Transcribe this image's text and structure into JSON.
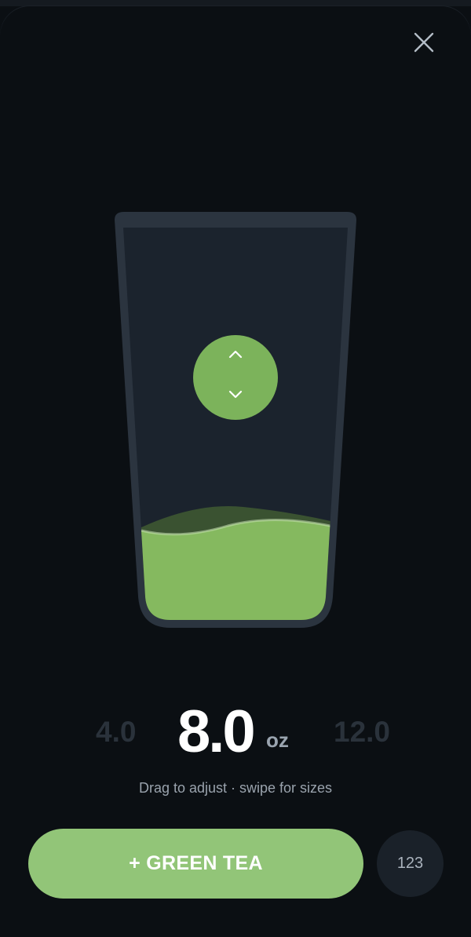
{
  "close": {
    "icon": "close-icon"
  },
  "glass": {
    "fill_fraction": 0.22,
    "liquid_color": "#85b95f",
    "glass_color": "#1b232d",
    "rim_color": "#2b343f"
  },
  "handle": {
    "up_icon": "chevron-up-icon",
    "down_icon": "chevron-down-icon",
    "color": "#7cb35b"
  },
  "sizes": {
    "previous": "4.0",
    "current": "8.0",
    "unit": "oz",
    "next": "12.0"
  },
  "hint": "Drag to adjust · swipe for sizes",
  "actions": {
    "add_label": "+ GREEN TEA",
    "keypad_label": "123",
    "accent": "#92c578"
  }
}
